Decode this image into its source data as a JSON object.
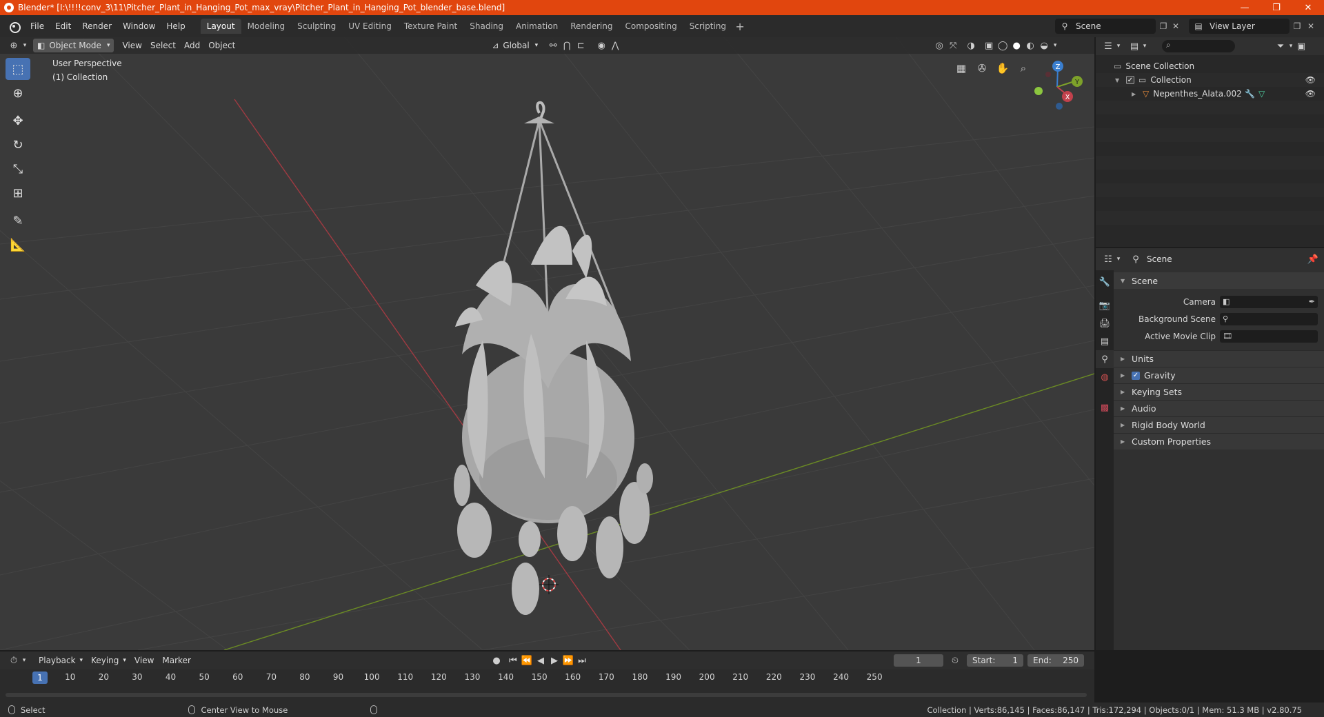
{
  "window": {
    "title": "Blender* [I:\\!!!!conv_3\\11\\Pitcher_Plant_in_Hanging_Pot_max_vray\\Pitcher_Plant_in_Hanging_Pot_blender_base.blend]",
    "minimize": "—",
    "maximize": "❐",
    "close": "✕"
  },
  "menu": [
    "File",
    "Edit",
    "Render",
    "Window",
    "Help"
  ],
  "workspaces": [
    "Layout",
    "Modeling",
    "Sculpting",
    "UV Editing",
    "Texture Paint",
    "Shading",
    "Animation",
    "Rendering",
    "Compositing",
    "Scripting"
  ],
  "active_workspace": "Layout",
  "scene_name": "Scene",
  "view_layer": "View Layer",
  "viewport": {
    "mode": "Object Mode",
    "menus": [
      "View",
      "Select",
      "Add",
      "Object"
    ],
    "orientation": "Global",
    "perspective_label": "User Perspective",
    "collection_label": "(1) Collection",
    "gizmo_axes": {
      "z": "Z",
      "y": "Y",
      "x": "X"
    }
  },
  "outliner": {
    "scene_collection": "Scene Collection",
    "collection": "Collection",
    "object": "Nepenthes_Alata.002"
  },
  "properties": {
    "header": "Scene",
    "panel": "Scene",
    "fields": {
      "camera": "Camera",
      "background_scene": "Background Scene",
      "active_movie_clip": "Active Movie Clip"
    },
    "subpanels": [
      "Units",
      "Gravity",
      "Keying Sets",
      "Audio",
      "Rigid Body World",
      "Custom Properties"
    ]
  },
  "timeline": {
    "menus": [
      "Playback",
      "Keying",
      "View",
      "Marker"
    ],
    "current_frame": "1",
    "start_label": "Start:",
    "start": "1",
    "end_label": "End:",
    "end": "250",
    "ticks": [
      "10",
      "20",
      "30",
      "40",
      "50",
      "60",
      "70",
      "80",
      "90",
      "100",
      "110",
      "120",
      "130",
      "140",
      "150",
      "160",
      "170",
      "180",
      "190",
      "200",
      "210",
      "220",
      "230",
      "240",
      "250"
    ],
    "ruler_current": "1"
  },
  "statusbar": {
    "select": "Select",
    "center_view": "Center View to Mouse",
    "stats": "Collection | Verts:86,145 | Faces:86,147 | Tris:172,294 | Objects:0/1 | Mem: 51.3 MB | v2.80.75"
  },
  "colors": {
    "titlebar": "#e1460e",
    "accent": "#4772b3",
    "x_axis": "#c2414c",
    "y_axis": "#7da12a",
    "z_axis": "#3a7fd0"
  }
}
